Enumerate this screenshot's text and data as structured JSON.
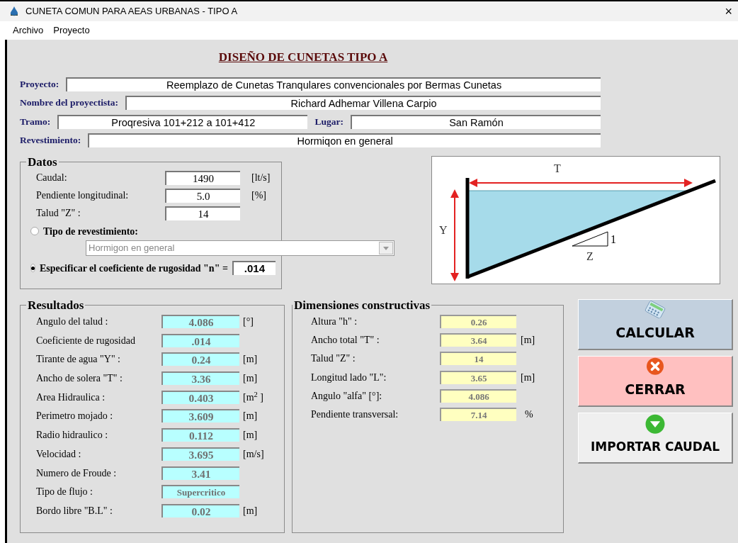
{
  "window": {
    "title": "CUNETA COMUN PARA AEAS URBANAS  - TIPO A",
    "close": "×"
  },
  "menu": [
    "Archivo",
    "Proyecto"
  ],
  "heading": "DISEÑO DE CUNETAS TIPO A",
  "info_rows": [
    [
      {
        "label": "Proyecto:",
        "value": "Reemplazo de Cunetas Tranqulares convencionales por Bermas Cunetas"
      }
    ],
    [
      {
        "label": "Nombre del proyectista:",
        "value": "Richard Adhemar Villena Carpio"
      }
    ],
    [
      {
        "label": "Tramo:",
        "value": "Proqresiva 101+212 a 101+412"
      },
      {
        "label": "Lugar:",
        "value": "San Ramón"
      }
    ],
    [
      {
        "label": "Revestimiento:",
        "value": "Hormiqon en general"
      }
    ]
  ],
  "datos": {
    "title": "Datos",
    "fields": [
      {
        "label": "Caudal:",
        "value": "1490",
        "unit": "[lt/s]"
      },
      {
        "label": "Pendiente longitudinal:",
        "value": "5.0",
        "unit": "[%]"
      },
      {
        "label": "Talud \"Z\" :",
        "value": "14"
      }
    ],
    "options": [
      {
        "label": "Tipo de revestimiento:",
        "selected": false
      },
      {
        "label": "Especificar el coeficiente de rugosidad \"n\" =",
        "selected": true
      }
    ],
    "dropdown": {
      "value": "Hormigon en general",
      "disabled": true
    },
    "n_value": ".014"
  },
  "diagram": {
    "top": "T",
    "side": "Y",
    "run": "Z",
    "rise": "1"
  },
  "resultados": {
    "title": "Resultados",
    "rows": [
      {
        "label": "Angulo del talud :",
        "value": "4.086",
        "unit": "[°]"
      },
      {
        "label": "Coeficiente de rugosidad",
        "value": ".014"
      },
      {
        "label": "Tirante de agua \"Y\" :",
        "value": "0.24",
        "unit": "[m]"
      },
      {
        "label": "Ancho de solera \"T\" :",
        "value": "3.36",
        "unit": "[m]"
      },
      {
        "label": "Area Hidraulica  :",
        "value": "0.403",
        "unit": "[m$^{2}$ ]"
      },
      {
        "label": "Perimetro mojado :",
        "value": "3.609",
        "unit": "[m]"
      },
      {
        "label": "Radio hidraulico :",
        "value": "0.112",
        "unit": "[m]"
      },
      {
        "label": "Velocidad  :",
        "value": "3.695",
        "unit": "[m/s]"
      },
      {
        "label": "Numero de Froude :",
        "value": "3.41"
      },
      {
        "label": "Tipo de flujo :",
        "value": "Supercritico"
      },
      {
        "label": "Bordo libre \"B.L\"  :",
        "value": "0.02",
        "unit": "[m]"
      }
    ]
  },
  "dimensiones": {
    "title": "Dimensiones constructivas",
    "rows": [
      {
        "label": "Altura \"h\"  :",
        "value": "0.26"
      },
      {
        "label": "Ancho total \"T\" :",
        "value": "3.64",
        "unit": "[m]"
      },
      {
        "label": "Talud \"Z\" :",
        "value": "14"
      },
      {
        "label": "Longitud  lado \"L\":",
        "value": "3.65",
        "unit": "[m]"
      },
      {
        "label": "Angulo \"alfa\" [°]:",
        "value": "4.086"
      },
      {
        "label": "Pendiente transversal:",
        "value": "7.14",
        "unit": "%"
      }
    ]
  },
  "buttons": [
    {
      "label": "CALCULAR",
      "kind": "calculate"
    },
    {
      "label": "CERRAR",
      "kind": "close"
    },
    {
      "label": "IMPORTAR CAUDAL",
      "kind": "import"
    }
  ]
}
